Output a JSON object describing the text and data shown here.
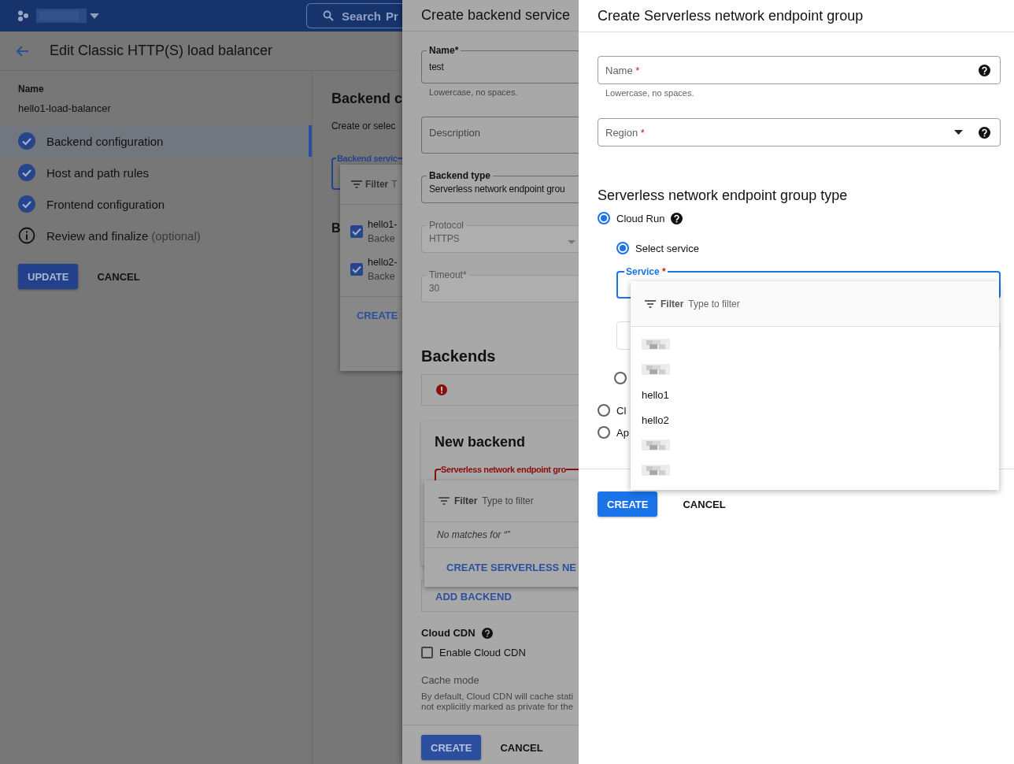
{
  "top_bar": {
    "search_label": "Search",
    "search_cut": "Pr"
  },
  "page": {
    "title": "Edit Classic HTTP(S) load balancer",
    "name_label": "Name",
    "name_value": "hello1-load-balancer",
    "steps": [
      {
        "label": "Backend configuration",
        "kind": "done",
        "selected": true
      },
      {
        "label": "Host and path rules",
        "kind": "done",
        "selected": false
      },
      {
        "label": "Frontend configuration",
        "kind": "done",
        "selected": false
      },
      {
        "label": "Review and finalize",
        "note": "(optional)",
        "kind": "info",
        "selected": false
      }
    ],
    "buttons": [
      {
        "label": "UPDATE",
        "kind": "primary"
      },
      {
        "label": "CANCEL",
        "kind": "text"
      }
    ],
    "backend": {
      "heading": "Backend c",
      "subtitle": "Create or selec",
      "field_label": "Backend servic",
      "heading_2": "B",
      "dropdown": {
        "filter_label": "Filter",
        "filter_placeholder": "T",
        "items": [
          {
            "name": "hello1-",
            "sub": "Backe",
            "checked": true
          },
          {
            "name": "hello2-",
            "sub": "Backe",
            "checked": true
          }
        ],
        "action": "CREATE"
      }
    }
  },
  "backend_service": {
    "title": "Create backend service",
    "fields": [
      {
        "kind": "input",
        "label": "Name",
        "required_mark": "*",
        "value": "test",
        "helper": "Lowercase, no spaces.",
        "disabled": false
      },
      {
        "kind": "textarea",
        "placeholder": "Description",
        "disabled": false
      },
      {
        "kind": "input",
        "label": "Backend type",
        "value": "Serverless network endpoint grou",
        "disabled": false
      },
      {
        "kind": "select",
        "label": "Protocol",
        "value": "HTTPS",
        "disabled": true
      },
      {
        "kind": "input",
        "label": "Timeout",
        "required_mark": "*",
        "value": "30",
        "disabled": true
      }
    ],
    "backends_heading": "Backends",
    "error": true,
    "new_backend": {
      "title": "New backend",
      "field_label": "Serverless network endpoint gro",
      "field_error": true,
      "dropdown": {
        "filter_label": "Filter",
        "filter_placeholder": "Type to filter",
        "empty": "No matches for “”",
        "action": "CREATE SERVERLESS NE"
      }
    },
    "add_button": "ADD BACKEND",
    "cdn_label": "Cloud CDN",
    "cdn_checkbox": {
      "label": "Enable Cloud CDN",
      "checked": false
    },
    "cache_label": "Cache mode",
    "cache_lines": [
      "By default, Cloud CDN will cache stati",
      "not explicitly marked as private for the"
    ],
    "buttons": [
      {
        "label": "CREATE",
        "kind": "primary"
      },
      {
        "label": "CANCEL",
        "kind": "text"
      }
    ]
  },
  "neg": {
    "title": "Create Serverless network endpoint group",
    "fields": [
      {
        "kind": "input",
        "label": "Name",
        "required_mark": "*",
        "helper": "Lowercase, no spaces."
      },
      {
        "kind": "select",
        "label": "Region",
        "required_mark": "*"
      }
    ],
    "type_heading": "Serverless network endpoint group type",
    "types": [
      {
        "label": "Cloud Run",
        "selected": true,
        "help": true,
        "options": [
          {
            "label": "Select service",
            "selected": true
          },
          {
            "selected": false
          }
        ]
      },
      {
        "label": "Cl",
        "selected": false
      },
      {
        "label": "Ap",
        "selected": false
      }
    ],
    "service_field": {
      "label": "Service",
      "required_mark": "*",
      "focused": true
    },
    "dropdown": {
      "filter_label": "Filter",
      "filter_placeholder": "Type to filter",
      "items": [
        {
          "kind": "redacted"
        },
        {
          "kind": "redacted"
        },
        {
          "kind": "text",
          "label": "hello1"
        },
        {
          "kind": "text",
          "label": "hello2"
        },
        {
          "kind": "redacted"
        },
        {
          "kind": "redacted"
        }
      ]
    },
    "buttons": [
      {
        "label": "CREATE",
        "kind": "primary"
      },
      {
        "label": "CANCEL",
        "kind": "text"
      }
    ]
  }
}
